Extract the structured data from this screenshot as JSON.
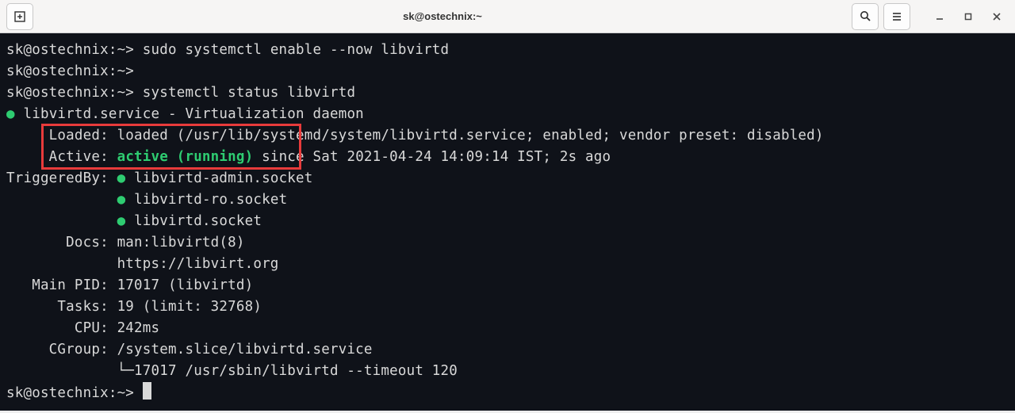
{
  "window": {
    "title": "sk@ostechnix:~"
  },
  "terminal": {
    "lines": {
      "l1_prompt": "sk@ostechnix:~>",
      "l1_cmd": " sudo systemctl enable --now libvirtd",
      "l2_prompt": "sk@ostechnix:~>",
      "l3_prompt": "sk@ostechnix:~>",
      "l3_cmd": " systemctl status libvirtd",
      "l4_bullet": "●",
      "l4_text": " libvirtd.service - Virtualization daemon",
      "l5": "     Loaded: loaded (/usr/lib/systemd/system/libvirtd.service; enabled; vendor preset: disabled)",
      "l6_a": "     Active: ",
      "l6_b": "active (running)",
      "l6_c": " since Sat 2021-04-24 14:09:14 IST; 2s ago",
      "l7_a": "TriggeredBy: ",
      "l7_bullet": "●",
      "l7_b": " libvirtd-admin.socket",
      "l8_a": "             ",
      "l8_bullet": "●",
      "l8_b": " libvirtd-ro.socket",
      "l9_a": "             ",
      "l9_bullet": "●",
      "l9_b": " libvirtd.socket",
      "l10": "       Docs: man:libvirtd(8)",
      "l11": "             https://libvirt.org",
      "l12": "   Main PID: 17017 (libvirtd)",
      "l13": "      Tasks: 19 (limit: 32768)",
      "l14": "        CPU: 242ms",
      "l15": "     CGroup: /system.slice/libvirtd.service",
      "l16": "             └─17017 /usr/sbin/libvirtd --timeout 120",
      "l17_prompt": "sk@ostechnix:~> "
    }
  }
}
